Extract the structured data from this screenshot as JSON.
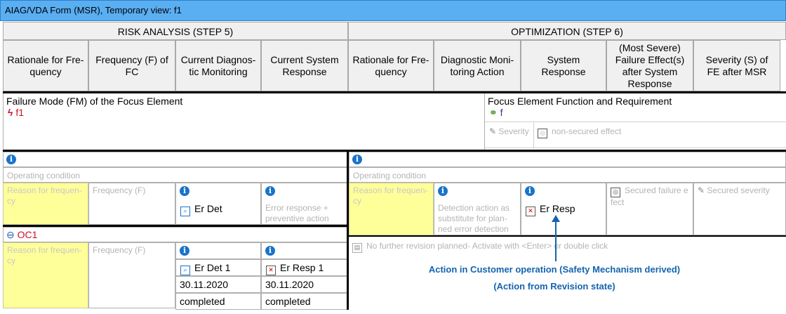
{
  "window": {
    "title": "AIAG/VDA Form (MSR), Temporary view: f1"
  },
  "sections": {
    "risk": "RISK ANALYSIS (STEP 5)",
    "opt": "OPTIMIZATION  (STEP 6)"
  },
  "columns": {
    "risk": [
      "Rationale for Fre-\nquency",
      "Frequency (F) of\nFC",
      "Current Diagnos-\ntic Monitoring",
      "Current System\nResponse"
    ],
    "opt": [
      "Rationale for Fre-\nquency",
      "Diagnostic Moni-\ntoring Action",
      "System\nResponse",
      "(Most Severe)\nFailure Effect(s)\nafter System\nResponse",
      "Severity (S) of\nFE after MSR"
    ]
  },
  "failure_mode": {
    "label": "Failure Mode (FM) of the Focus Element",
    "value": "f1"
  },
  "focus_function": {
    "label": "Focus Element Function and Requirement",
    "value": "f",
    "severity": "Severity",
    "non_secured": "non-secured effect"
  },
  "left_block1": {
    "operating_condition": "Operating condition",
    "reason": "Reason for frequen-\ncy",
    "frequency": "Frequency (F)",
    "detection": "Er Det",
    "response_placeholder": "Error response +\npreventive action"
  },
  "right_block1": {
    "operating_condition": "Operating condition",
    "reason": "Reason for frequen-\ncy",
    "detection_placeholder": "Detection action as\nsubstitute for plan-\nned error detection",
    "response": "Er Resp",
    "secured_failure": "Secured failure e\nfect",
    "secured_severity": "Secured severity"
  },
  "oc1": {
    "label": "OC1",
    "reason": "Reason for frequen-\ncy",
    "frequency": "Frequency (F)",
    "detection": "Er Det 1",
    "response": "Er Resp 1",
    "date_det": "30.11.2020",
    "date_resp": "30.11.2020",
    "status_det": "completed",
    "status_resp": "completed"
  },
  "revision_note": "No further revision planned- Activate with <Enter> or double click",
  "annotation": {
    "line1": "Action in Customer operation (Safety Mechanism derived)",
    "line2": "(Action from Revision state)"
  },
  "colors": {
    "titlebar": "#5aaef2",
    "yellow": "#ffff99",
    "info": "#1a73c8",
    "note": "#1463ae",
    "fm_red": "#d0102a"
  }
}
